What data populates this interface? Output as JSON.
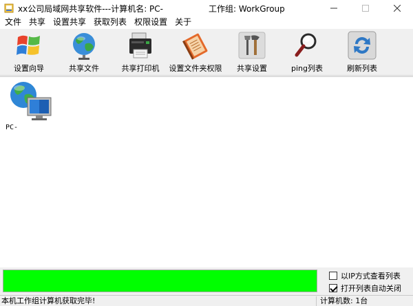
{
  "window": {
    "title": "xx公司局域网共享软件---计算机名: PC-",
    "workgroup": "工作组: WorkGroup"
  },
  "menu": [
    "文件",
    "共享",
    "设置共享",
    "获取列表",
    "权限设置",
    "关于"
  ],
  "toolbar": [
    {
      "label": "设置向导",
      "icon": "windows-flag-icon"
    },
    {
      "label": "共享文件",
      "icon": "globe-icon"
    },
    {
      "label": "共享打印机",
      "icon": "printer-icon"
    },
    {
      "label": "设置文件夹权限",
      "icon": "notebook-icon"
    },
    {
      "label": "共享设置",
      "icon": "tools-icon"
    },
    {
      "label": "ping列表",
      "icon": "magnifier-icon"
    },
    {
      "label": "刷新列表",
      "icon": "refresh-icon"
    }
  ],
  "computers": [
    {
      "name": "PC-",
      "icon": "network-computer-icon"
    }
  ],
  "progress": {
    "percent": 100,
    "color": "#00ff00"
  },
  "options": [
    {
      "label": "以IP方式查看列表",
      "checked": false
    },
    {
      "label": "打开列表自动关闭",
      "checked": true
    }
  ],
  "status": {
    "message": "本机工作组计算机获取完毕!",
    "count": "计算机数: 1台"
  }
}
